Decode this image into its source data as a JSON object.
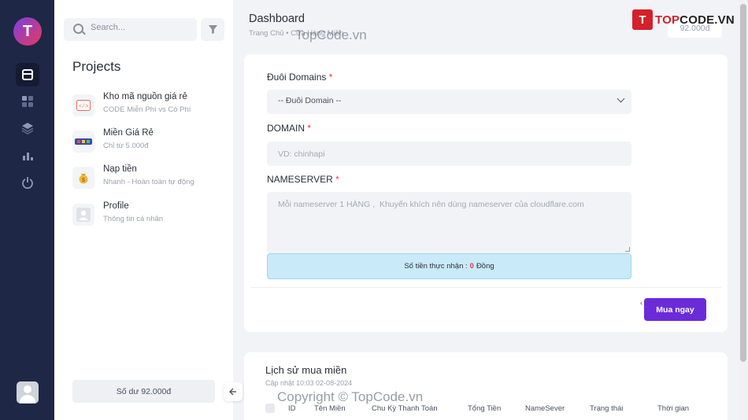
{
  "rail": {
    "logo_letter": "T",
    "items": [
      {
        "icon": "layout-icon"
      },
      {
        "icon": "grid-icon"
      },
      {
        "icon": "layers-icon"
      },
      {
        "icon": "chart-icon"
      },
      {
        "icon": "power-icon"
      }
    ]
  },
  "panel": {
    "search_placeholder": "Search...",
    "title": "Projects",
    "items": [
      {
        "title": "Kho mã nguồn giá rẻ",
        "subtitle": "CODE Miễn Phí vs Có Phí"
      },
      {
        "title": "Miền Giá Rẻ",
        "subtitle": "Chỉ từ 5.000đ"
      },
      {
        "title": "Nạp tiền",
        "subtitle": "Nhanh - Hoàn toàn tự động"
      },
      {
        "title": "Profile",
        "subtitle": "Thông tin cá nhân"
      }
    ],
    "balance": "Số dư 92.000đ"
  },
  "header": {
    "title": "Dashboard",
    "breadcrumb": [
      "Trang Chủ",
      "Cửa Hàng Miền"
    ],
    "balance": "92.000đ"
  },
  "watermarks": {
    "top": "TopCode.vn",
    "bottom": "Copyright © TopCode.vn"
  },
  "brand": {
    "icon_text": "T",
    "prefix": "TOP",
    "suffix": "CODE.VN"
  },
  "form": {
    "domain_ext_label": "Đuôi Domains",
    "domain_ext_selected": "-- Đuôi Domain --",
    "domain_label": "DOMAIN",
    "domain_placeholder": "VD: chinhapi",
    "ns_label": "NAMESERVER",
    "ns_placeholder": "Mỗi nameserver 1 HÀNG ,  Khuyến khích nên dùng nameserver của cloudflare.com",
    "required_mark": "*",
    "amount_prefix": "Số tiền thực nhận :",
    "amount_value": "0",
    "amount_unit": "Đồng",
    "buy_label": "Mua ngay"
  },
  "history": {
    "title": "Lịch sử mua miền",
    "updated": "Cập nhật 10:03 02-08-2024",
    "columns": [
      "ID",
      "Tên Miền",
      "Chu Kỳ Thanh Toán",
      "Tổng Tiền",
      "NameSever",
      "Trạng thái",
      "Thời gian"
    ]
  }
}
